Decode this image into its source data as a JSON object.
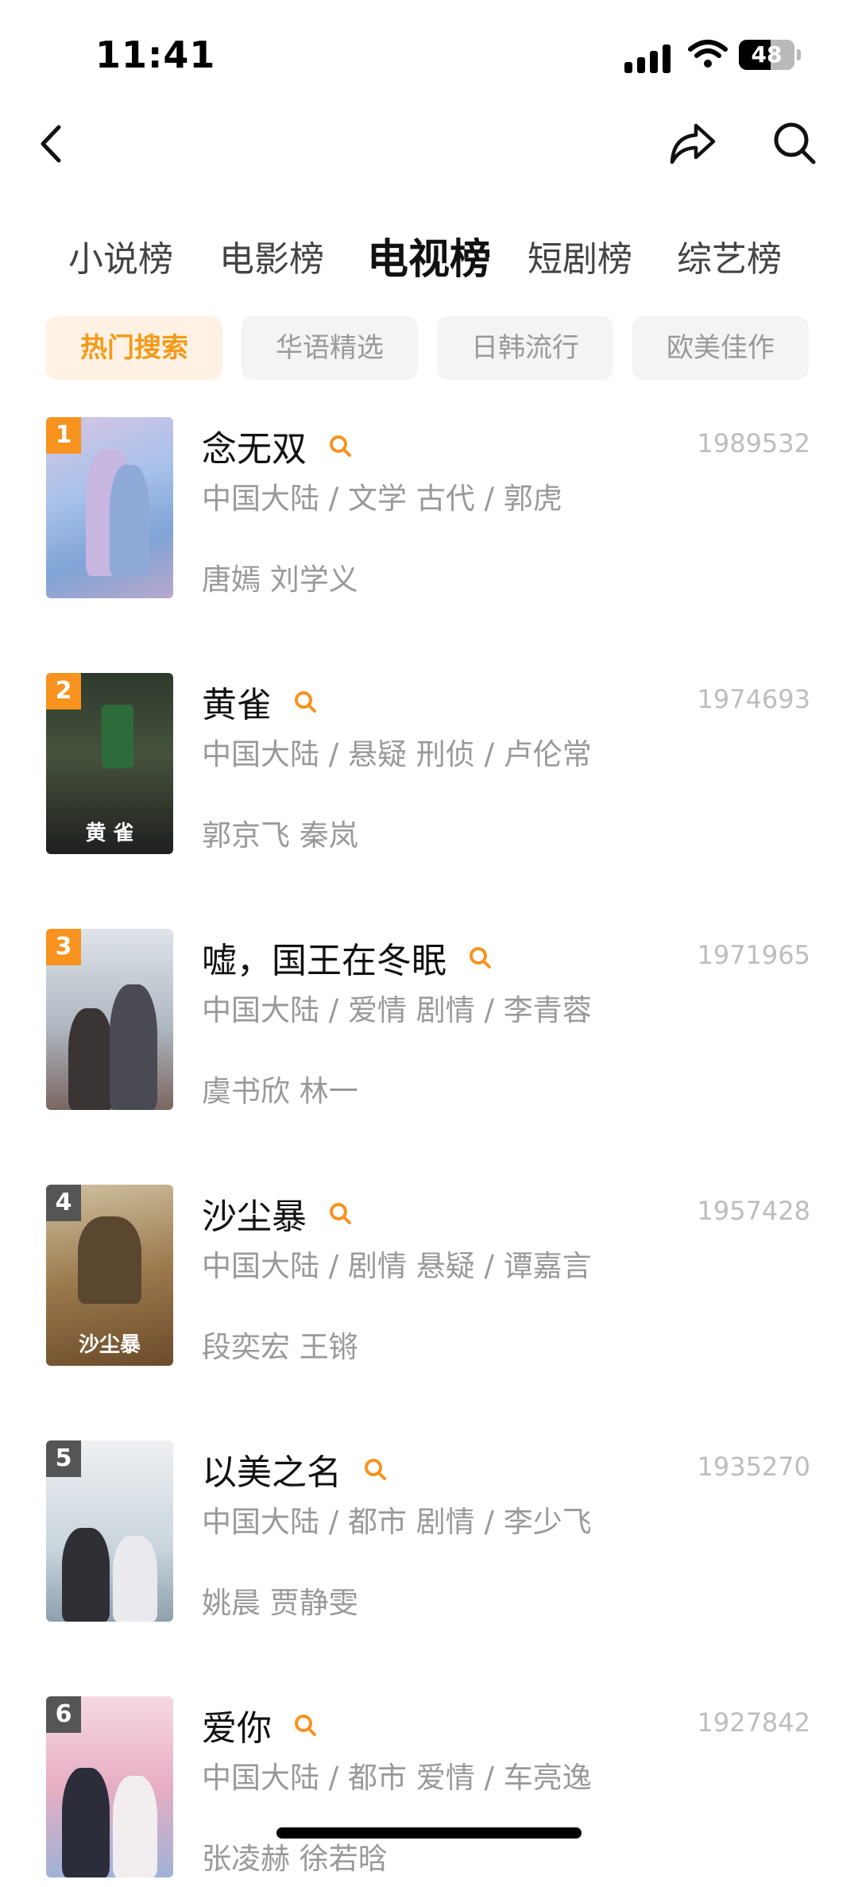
{
  "status_bar": {
    "time": "11:41",
    "battery": "48"
  },
  "nav": {
    "back_icon": "chevron-left-icon",
    "share_icon": "share-arrow-icon",
    "search_icon": "search-icon"
  },
  "tabs": [
    {
      "label": "小说榜",
      "active": false
    },
    {
      "label": "电影榜",
      "active": false
    },
    {
      "label": "电视榜",
      "active": true
    },
    {
      "label": "短剧榜",
      "active": false
    },
    {
      "label": "综艺榜",
      "active": false
    }
  ],
  "chips": [
    {
      "label": "热门搜索",
      "active": true
    },
    {
      "label": "华语精选",
      "active": false
    },
    {
      "label": "日韩流行",
      "active": false
    },
    {
      "label": "欧美佳作",
      "active": false
    }
  ],
  "colors": {
    "accent": "#f7931e",
    "chip_active_bg": "#fff2e4",
    "muted_text": "#999999"
  },
  "items": [
    {
      "rank": "1",
      "title": "念无双",
      "meta": "中国大陆 / 文学 古代 / 郭虎",
      "cast": "唐嫣 刘学义",
      "score": "1989532"
    },
    {
      "rank": "2",
      "title": "黄雀",
      "meta": "中国大陆 / 悬疑 刑侦 / 卢伦常",
      "cast": "郭京飞 秦岚",
      "score": "1974693",
      "poster_text": "黄  雀"
    },
    {
      "rank": "3",
      "title": "嘘，国王在冬眠",
      "meta": "中国大陆 / 爱情 剧情 / 李青蓉",
      "cast": "虞书欣 林一",
      "score": "1971965"
    },
    {
      "rank": "4",
      "title": "沙尘暴",
      "meta": "中国大陆 / 剧情 悬疑 / 谭嘉言",
      "cast": "段奕宏 王锵",
      "score": "1957428",
      "poster_text": "沙尘暴"
    },
    {
      "rank": "5",
      "title": "以美之名",
      "meta": "中国大陆 / 都市 剧情 / 李少飞",
      "cast": "姚晨 贾静雯",
      "score": "1935270"
    },
    {
      "rank": "6",
      "title": "爱你",
      "meta": "中国大陆 / 都市 爱情 / 车亮逸",
      "cast": "张凌赫 徐若晗",
      "score": "1927842"
    }
  ]
}
